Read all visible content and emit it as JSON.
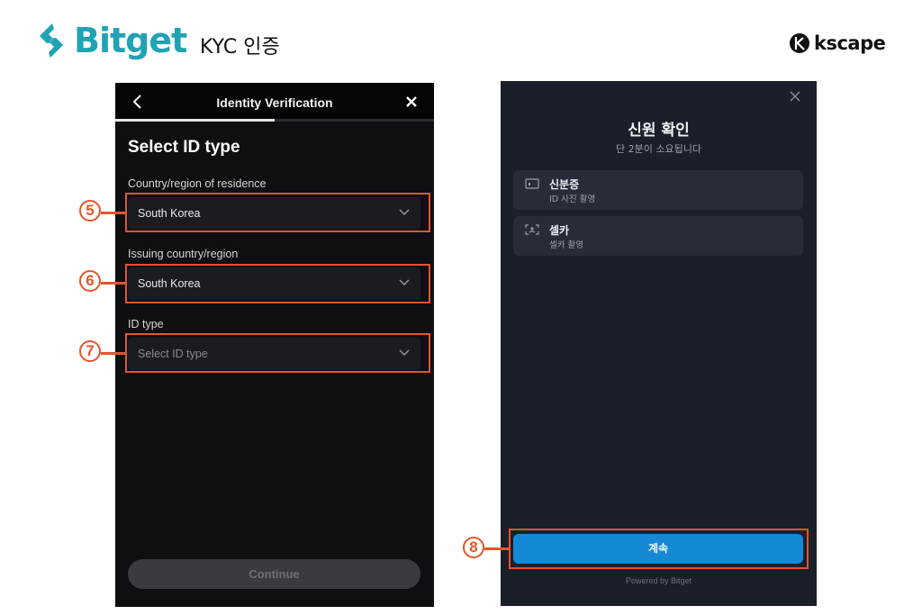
{
  "header": {
    "brand_name": "Bitget",
    "page_title": "KYC 인증",
    "partner_name": "kscape",
    "brand_color": "#1fa3b5"
  },
  "left_screen": {
    "nav": {
      "back_icon": "chevron-left-icon",
      "title": "Identity Verification",
      "close_icon": "close-x-icon"
    },
    "progress_percent": 50,
    "section_title": "Select ID type",
    "fields": [
      {
        "label": "Country/region of residence",
        "value": "South Korea",
        "placeholder": "",
        "step": "5"
      },
      {
        "label": "Issuing country/region",
        "value": "South Korea",
        "placeholder": "",
        "step": "6"
      },
      {
        "label": "ID type",
        "value": "",
        "placeholder": "Select ID type",
        "step": "7"
      }
    ],
    "continue_label": "Continue"
  },
  "right_screen": {
    "close_icon": "close-x-icon",
    "title": "신원 확인",
    "subtitle": "단 2분이 소요됩니다",
    "options": [
      {
        "icon": "id-card-icon",
        "title": "신분증",
        "subtitle": "ID 사진 촬영"
      },
      {
        "icon": "selfie-frame-icon",
        "title": "셀카",
        "subtitle": "셀카 촬영"
      }
    ],
    "proceed_label": "계속",
    "proceed_step": "8",
    "powered_by": "Powered by Bitget",
    "accent_color": "#1588d6"
  },
  "annotation_color": "#e4542d"
}
